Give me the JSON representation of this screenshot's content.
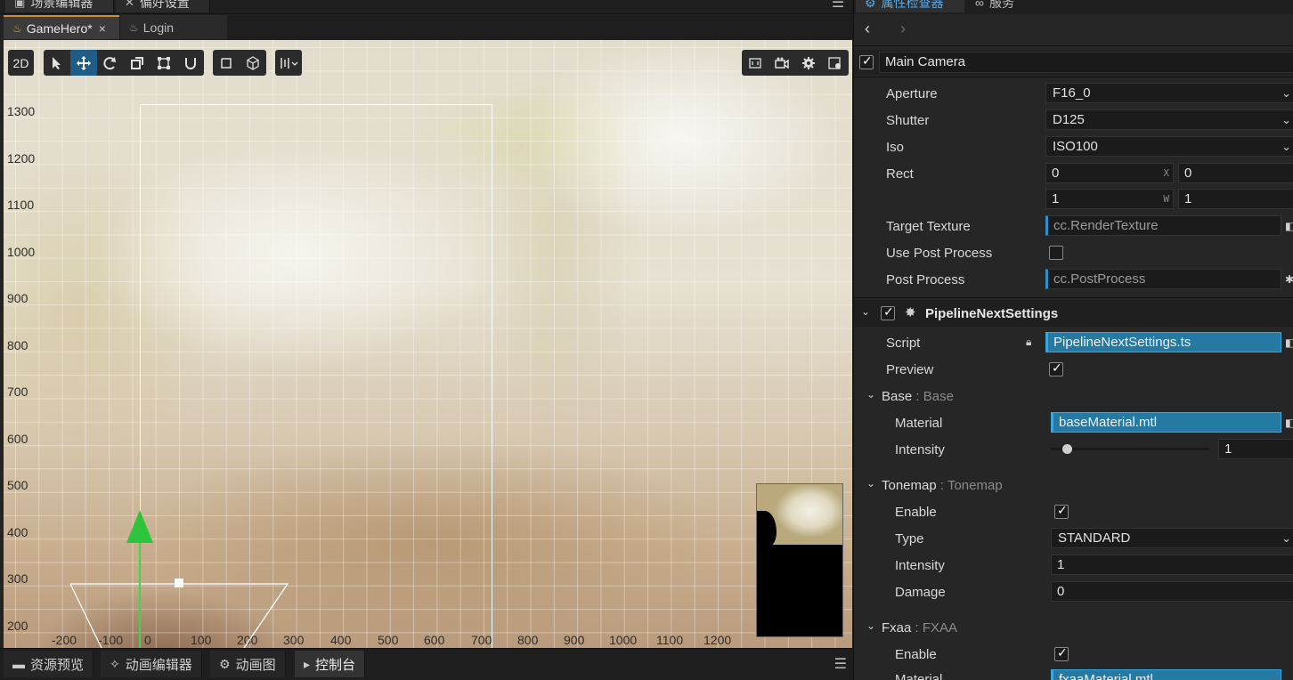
{
  "left_panel": {
    "top_tabs": [
      {
        "label": "场景编辑器",
        "icon": "scene-icon"
      },
      {
        "label": "偏好设置",
        "icon": "wrench-icon"
      }
    ],
    "doc_tabs": [
      {
        "label": "GameHero*",
        "icon": "fire-icon",
        "active": true
      },
      {
        "label": "Login",
        "icon": "fire-icon",
        "active": false
      }
    ],
    "toolbar": {
      "mode_2d": "2D",
      "tools": [
        "select-tool",
        "move-tool",
        "rotate-tool",
        "scale-tool",
        "rect-tool",
        "snap-tool"
      ],
      "right_tools": [
        "resolution-icon",
        "camera-icon",
        "settings-icon",
        "gizmo-icon"
      ]
    },
    "y_axis_labels": [
      "1300",
      "1200",
      "1100",
      "1000",
      "900",
      "800",
      "700",
      "600",
      "500",
      "400",
      "300",
      "200"
    ],
    "x_axis_labels": [
      "-200",
      "-100",
      "0",
      "100",
      "200",
      "300",
      "400",
      "500",
      "600",
      "700",
      "800",
      "900",
      "1000",
      "1100",
      "1200"
    ],
    "bottom_tabs": [
      {
        "label": "资源预览",
        "icon": "asset-preview-icon"
      },
      {
        "label": "动画编辑器",
        "icon": "animation-icon"
      },
      {
        "label": "动画图",
        "icon": "animation-graph-icon"
      },
      {
        "label": "控制台",
        "icon": "console-icon",
        "active": true
      }
    ]
  },
  "inspector": {
    "tabs": [
      {
        "label": "属性检查器",
        "icon": "inspector-icon",
        "active": true
      },
      {
        "label": "服务",
        "icon": "services-icon"
      }
    ],
    "node_name": "Main Camera",
    "node_enabled": true,
    "camera_props": {
      "aperture_label": "Aperture",
      "aperture_value": "F16_0",
      "shutter_label": "Shutter",
      "shutter_value": "D125",
      "iso_label": "Iso",
      "iso_value": "ISO100",
      "rect_label": "Rect",
      "rect_x": "0",
      "rect_y": "0",
      "rect_w": "1",
      "rect_h": "1",
      "rect_x_suffix": "X",
      "rect_w_suffix": "W",
      "target_texture_label": "Target Texture",
      "target_texture_value": "cc.RenderTexture",
      "use_post_process_label": "Use Post Process",
      "use_post_process": false,
      "post_process_label": "Post Process",
      "post_process_value": "cc.PostProcess"
    },
    "component": {
      "title": "PipelineNextSettings",
      "enabled": true,
      "script_label": "Script",
      "script_value": "PipelineNextSettings.ts",
      "preview_label": "Preview",
      "preview": true,
      "base": {
        "title": "Base",
        "type": "Base",
        "material_label": "Material",
        "material_value": "baseMaterial.mtl",
        "intensity_label": "Intensity",
        "intensity_value": "1",
        "intensity_fraction": 0.1
      },
      "tonemap": {
        "title": "Tonemap",
        "type": "Tonemap",
        "enable_label": "Enable",
        "enable": true,
        "type_label": "Type",
        "type_value": "STANDARD",
        "intensity_label": "Intensity",
        "intensity_value": "1",
        "damage_label": "Damage",
        "damage_value": "0"
      },
      "fxaa": {
        "title": "Fxaa",
        "type": "FXAA",
        "enable_label": "Enable",
        "enable": true,
        "material_label": "Material",
        "material_value": "fxaaMaterial.mtl"
      }
    }
  },
  "colors": {
    "accent_blue": "#247aa3",
    "tab_accent_orange": "#d48a2e",
    "inspector_tab_blue": "#5aa9e6",
    "gizmo_green": "#2fc43d"
  }
}
